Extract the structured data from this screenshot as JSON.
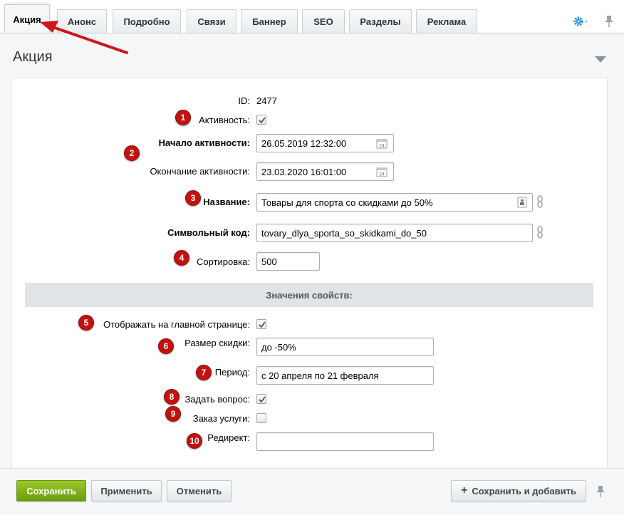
{
  "tabs": [
    {
      "label": "Акция",
      "active": true
    },
    {
      "label": "Анонс"
    },
    {
      "label": "Подробно"
    },
    {
      "label": "Связи"
    },
    {
      "label": "Баннер"
    },
    {
      "label": "SEO"
    },
    {
      "label": "Разделы"
    },
    {
      "label": "Реклама"
    }
  ],
  "panel": {
    "title": "Акция"
  },
  "form": {
    "id_label": "ID:",
    "id_value": "2477",
    "active_label": "Активность:",
    "active_checked": true,
    "start_label": "Начало активности:",
    "start_value": "26.05.2019 12:32:00",
    "end_label": "Окончание активности:",
    "end_value": "23.03.2020 16:01:00",
    "name_label": "Название:",
    "name_value": "Товары для спорта со скидками до 50%",
    "code_label": "Символьный код:",
    "code_value": "tovary_dlya_sporta_so_skidkami_do_50",
    "sort_label": "Сортировка:",
    "sort_value": "500"
  },
  "properties": {
    "section_title": "Значения свойств:",
    "show_main_label": "Отображать на главной странице:",
    "show_main_checked": true,
    "discount_label": "Размер скидки:",
    "discount_value": "до -50%",
    "period_label": "Период:",
    "period_value": "с 20 апреля по 21 февраля",
    "ask_label": "Задать вопрос:",
    "ask_checked": true,
    "order_label": "Заказ услуги:",
    "order_checked": false,
    "redirect_label": "Редирект:",
    "redirect_value": ""
  },
  "badges": [
    "1",
    "2",
    "3",
    "4",
    "5",
    "6",
    "7",
    "8",
    "9",
    "10"
  ],
  "footer": {
    "save": "Сохранить",
    "apply": "Применить",
    "cancel": "Отменить",
    "save_add": "Сохранить и добавить"
  },
  "colors": {
    "accent_green": "#7aa81a",
    "badge_red": "#c3120f",
    "gear_blue": "#1b8de6"
  }
}
